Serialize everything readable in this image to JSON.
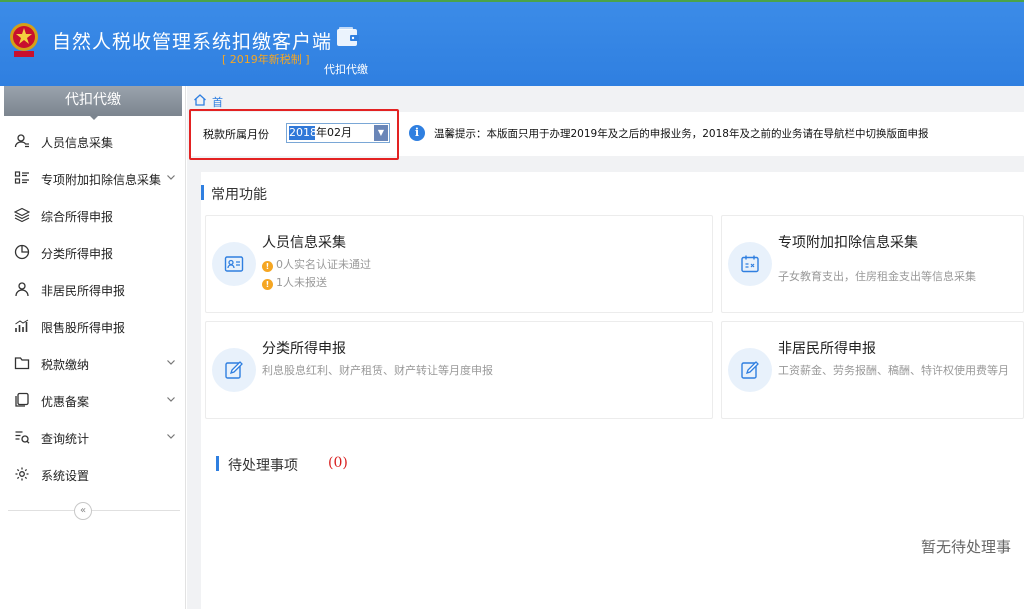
{
  "header": {
    "app_title": "自然人税收管理系统扣缴客户端",
    "app_subtitle": "[ 2019年新税制 ]",
    "module_label": "代扣代缴"
  },
  "sidebar": {
    "heading": "代扣代缴",
    "items": [
      {
        "label": "人员信息采集",
        "icon": "person-card-icon",
        "has_children": false
      },
      {
        "label": "专项附加扣除信息采集",
        "icon": "list-icon",
        "has_children": true
      },
      {
        "label": "综合所得申报",
        "icon": "layers-icon",
        "has_children": false
      },
      {
        "label": "分类所得申报",
        "icon": "pie-icon",
        "has_children": false
      },
      {
        "label": "非居民所得申报",
        "icon": "person-icon",
        "has_children": false
      },
      {
        "label": "限售股所得申报",
        "icon": "bar-chart-icon",
        "has_children": false
      },
      {
        "label": "税款缴纳",
        "icon": "folder-icon",
        "has_children": true
      },
      {
        "label": "优惠备案",
        "icon": "copy-icon",
        "has_children": true
      },
      {
        "label": "查询统计",
        "icon": "search-list-icon",
        "has_children": true
      },
      {
        "label": "系统设置",
        "icon": "gear-icon",
        "has_children": false
      }
    ],
    "collapse_glyph": "«"
  },
  "breadcrumb": {
    "home_label": "首页"
  },
  "filter": {
    "period_label": "税款所属月份",
    "period_year": "2018",
    "period_rest": "年02月",
    "info_glyph": "i",
    "tip": "温馨提示：本版面只用于办理2019年及之后的申报业务，2018年及之前的业务请在导航栏中切换版面申报"
  },
  "common": {
    "title": "常用功能",
    "cards": [
      {
        "title": "人员信息采集",
        "lines": [
          "0人实名认证未通过",
          "1人未报送"
        ],
        "icon": "id-card-icon"
      },
      {
        "title": "专项附加扣除信息采集",
        "lines": [
          "子女教育支出，住房租金支出等信息采集"
        ],
        "icon": "calendar-tax-icon"
      },
      {
        "title": "分类所得申报",
        "lines": [
          "利息股息红利、财产租赁、财产转让等月度申报"
        ],
        "icon": "edit-icon"
      },
      {
        "title": "非居民所得申报",
        "lines": [
          "工资薪金、劳务报酬、稿酬、特许权使用费等月"
        ],
        "icon": "edit-icon"
      }
    ],
    "warn_glyph": "!"
  },
  "pending": {
    "title": "待处理事项",
    "count": "(0)",
    "empty_text": "暂无待处理事"
  },
  "colors": {
    "header_blue": "#2f7fe0",
    "accent_orange": "#f5a623",
    "highlight_red": "#e32222"
  }
}
